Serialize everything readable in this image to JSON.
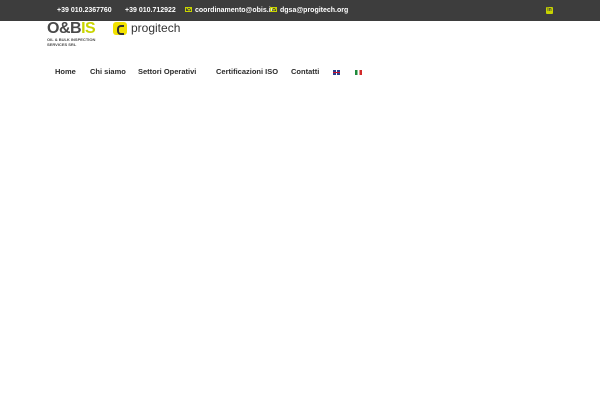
{
  "topbar": {
    "phone1": "+39 010.2367760",
    "phone2": "+39 010.712922",
    "email1": "coordinamento@obis.it",
    "email2": "dgsa@progitech.org",
    "social_icon": "linkedin-icon"
  },
  "logos": {
    "obis_mark_left": "O&B",
    "obis_mark_right": "IS",
    "obis_sub": "OIL & BULK INSPECTION SERVICES SRL",
    "progitech_word": "progitech"
  },
  "nav": {
    "items": [
      "Home",
      "Chi siamo",
      "Settori Operativi",
      "Certificazioni ISO",
      "Contatti"
    ]
  },
  "languages": [
    "English",
    "Italiano"
  ],
  "colors": {
    "topbar_bg": "#3d3d3d",
    "accent": "#c8d400",
    "progitech_yellow": "#f2e200"
  }
}
